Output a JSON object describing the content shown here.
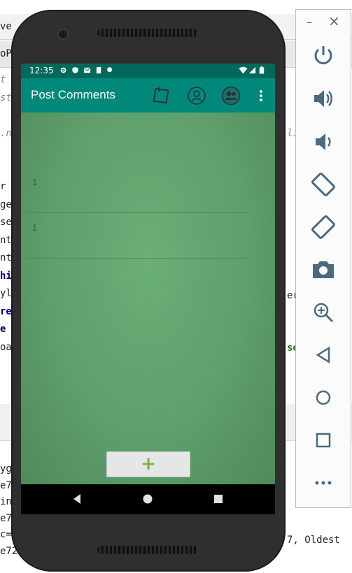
{
  "ide": {
    "top_fragment": "ve",
    "tab_fragment": "oP",
    "code_lines": [
      {
        "text": "t",
        "style": "it"
      },
      {
        "text": "st",
        "style": "it"
      },
      {
        "text": "",
        "style": ""
      },
      {
        "text": ".n",
        "style": "it"
      },
      {
        "text": "",
        "style": ""
      },
      {
        "text": "",
        "style": ""
      },
      {
        "text": "r",
        "style": ""
      },
      {
        "text": "ge",
        "style": ""
      },
      {
        "text": "se",
        "style": ""
      },
      {
        "text": "nt",
        "style": ""
      },
      {
        "text": "nt",
        "style": ""
      },
      {
        "text": "hi",
        "style": "kw"
      },
      {
        "text": "yl",
        "style": ""
      },
      {
        "text": "re",
        "style": "kw"
      },
      {
        "text": "e",
        "style": "kw"
      },
      {
        "text": "oa",
        "style": ""
      }
    ],
    "right_fragments": [
      "li",
      "er",
      "se"
    ],
    "lower_lines": [
      "yg",
      "e7",
      "in",
      "e7",
      "c=",
      "e72"
    ],
    "lower_right": "7, Oldest"
  },
  "phone": {
    "status_time": "12:35",
    "app_title": "Post Comments",
    "rows": [
      "1",
      "1"
    ],
    "add_button": "+"
  },
  "emulator": {
    "minimize": "–",
    "close": "×",
    "buttons": [
      "power-icon",
      "volume-up-icon",
      "volume-down-icon",
      "rotate-left-icon",
      "rotate-right-icon",
      "camera-icon",
      "zoom-icon",
      "back-icon",
      "home-icon",
      "overview-icon",
      "more-icon"
    ]
  },
  "colors": {
    "status_bar": "#00695c",
    "app_bar": "#00897b",
    "content_green": "#5e9f6b",
    "plus": "#7bb342",
    "emu_icon": "#4a6a80"
  }
}
